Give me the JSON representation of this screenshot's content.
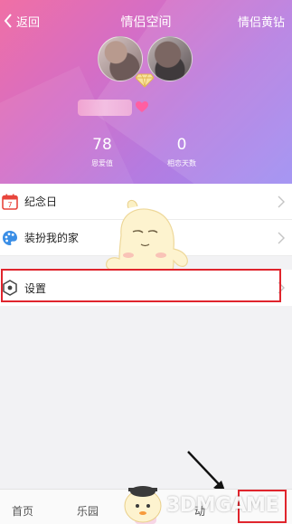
{
  "header": {
    "back_label": "返回",
    "title": "情侣空间",
    "right_link": "情侣黄钻",
    "stats": [
      {
        "value": "78",
        "label": "恩爱值"
      },
      {
        "value": "0",
        "label": "相恋天数"
      }
    ]
  },
  "menu": {
    "items": [
      {
        "label": "纪念日",
        "icon": "calendar-icon",
        "calendar_day": "7"
      },
      {
        "label": "装扮我的家",
        "icon": "palette-icon"
      }
    ],
    "settings": {
      "label": "设置",
      "icon": "settings-hex-icon"
    }
  },
  "tabbar": {
    "items": [
      {
        "label": "首页"
      },
      {
        "label": "乐园"
      },
      {
        "label": "动"
      }
    ]
  },
  "watermark": {
    "text": "3DMGAME"
  },
  "colors": {
    "header_gradient_start": "#f06fa5",
    "header_gradient_end": "#9c8cf2",
    "highlight_red": "#e0252d",
    "calendar_red": "#e8453c",
    "palette_blue": "#3a8ee6"
  }
}
